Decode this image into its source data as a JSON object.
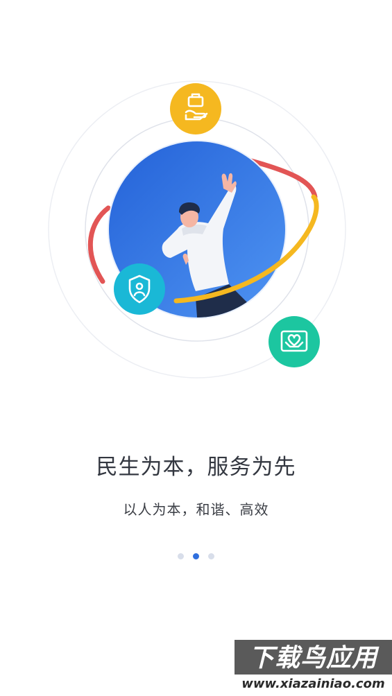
{
  "slide": {
    "title": "民生为本，服务为先",
    "subtitle": "以人为本，和谐、高效"
  },
  "pager": {
    "total": 3,
    "active_index": 1
  },
  "illustration": {
    "icons": [
      "hand-gift-icon",
      "shield-person-icon",
      "heart-care-icon"
    ],
    "colors": {
      "primary_blue": "#2f6fde",
      "light_blue": "#4a8cf0",
      "yellow": "#f5b820",
      "red": "#e25555",
      "teal": "#1ab8d6",
      "green": "#1cc6a0"
    }
  },
  "watermark": {
    "main": "下载鸟应用",
    "sub": "www.xiazainiao.com"
  }
}
